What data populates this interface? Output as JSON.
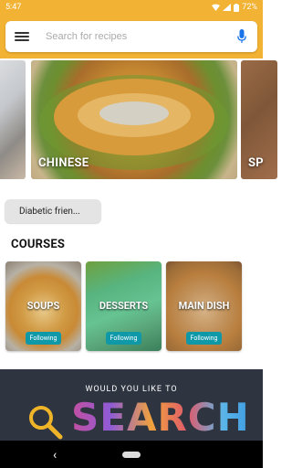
{
  "status": {
    "time": "5:47",
    "battery": "72%"
  },
  "search": {
    "placeholder": "Search for recipes"
  },
  "carousel": {
    "slides": [
      "CHINESE",
      "SP"
    ]
  },
  "filter": {
    "label": "Diabetic frien..."
  },
  "courses": {
    "title": "COURSES",
    "items": [
      {
        "label": "SOUPS",
        "badge": "Following"
      },
      {
        "label": "DESSERTS",
        "badge": "Following"
      },
      {
        "label": "MAIN DISH",
        "badge": "Following"
      }
    ]
  },
  "banner": {
    "line1": "WOULD YOU LIKE TO",
    "line2": "SEARCH"
  },
  "colors": {
    "accent": "#f2b233",
    "teal": "#0e98a8"
  },
  "icons": [
    "menu-icon",
    "mic-icon",
    "wifi-icon",
    "signal-icon",
    "battery-icon",
    "back-icon"
  ]
}
